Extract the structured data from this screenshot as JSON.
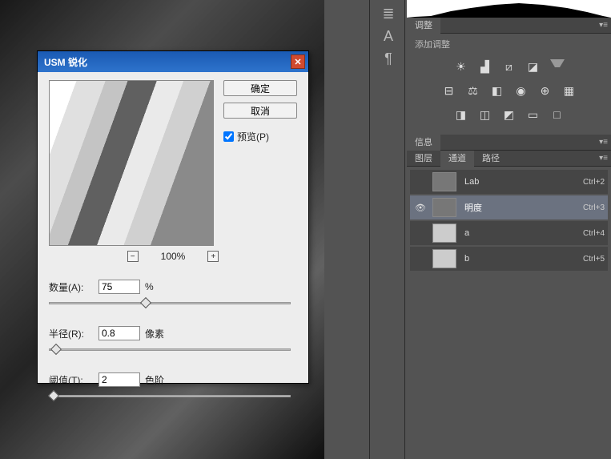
{
  "dialog": {
    "title": "USM 锐化",
    "ok_label": "确定",
    "cancel_label": "取消",
    "preview_label": "预览(P)",
    "preview_checked": true,
    "zoom": {
      "minus": "−",
      "value": "100%",
      "plus": "+"
    },
    "amount": {
      "label": "数量(A):",
      "value": "75",
      "unit": "%",
      "slider_pct": 40
    },
    "radius": {
      "label": "半径(R):",
      "value": "0.8",
      "unit": "像素",
      "slider_pct": 3
    },
    "threshold": {
      "label": "阈值(T):",
      "value": "2",
      "unit": "色阶",
      "slider_pct": 2
    }
  },
  "right": {
    "adjust_tab": "调整",
    "adjust_sub": "添加调整",
    "info_tab": "信息",
    "tabs": {
      "layers": "图层",
      "channels": "通道",
      "paths": "路径"
    },
    "channels": [
      {
        "name": "Lab",
        "shortcut": "Ctrl+2",
        "visible": false
      },
      {
        "name": "明度",
        "shortcut": "Ctrl+3",
        "visible": true,
        "selected": true
      },
      {
        "name": "a",
        "shortcut": "Ctrl+4",
        "visible": false
      },
      {
        "name": "b",
        "shortcut": "Ctrl+5",
        "visible": false
      }
    ]
  },
  "toolstrip": {
    "icon1": "≣",
    "icon2": "A",
    "icon3": "¶"
  }
}
